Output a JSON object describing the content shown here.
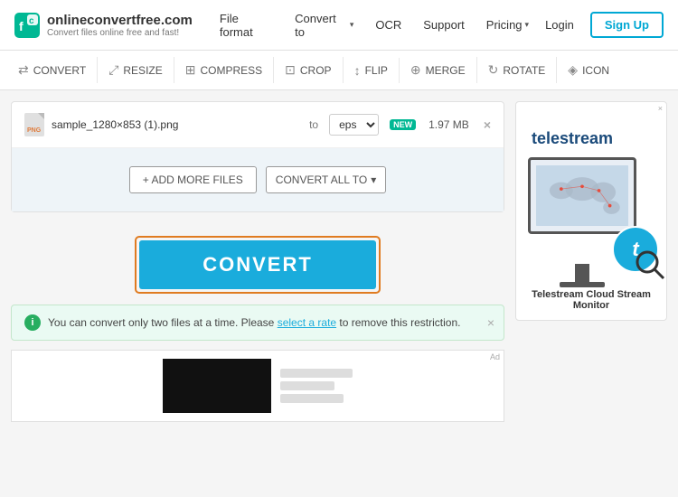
{
  "header": {
    "logo_title": "onlineconvertfree.com",
    "logo_subtitle": "Convert files online free and fast!",
    "nav_items": [
      {
        "label": "File format",
        "has_arrow": false
      },
      {
        "label": "Convert to",
        "has_arrow": true
      },
      {
        "label": "OCR",
        "has_arrow": false
      },
      {
        "label": "Support",
        "has_arrow": false
      },
      {
        "label": "Pricing",
        "has_arrow": true
      }
    ],
    "login_label": "Login",
    "signup_label": "Sign Up"
  },
  "toolbar": {
    "items": [
      {
        "label": "CONVERT",
        "icon": "⇄"
      },
      {
        "label": "RESIZE",
        "icon": "⤢"
      },
      {
        "label": "COMPRESS",
        "icon": "⊞"
      },
      {
        "label": "CROP",
        "icon": "⊡"
      },
      {
        "label": "FLIP",
        "icon": "↕"
      },
      {
        "label": "MERGE",
        "icon": "⊕"
      },
      {
        "label": "ROTATE",
        "icon": "↻"
      },
      {
        "label": "ICON",
        "icon": "◈"
      }
    ]
  },
  "file_converter": {
    "file_name": "sample_1280×853 (1).png",
    "file_type": "png",
    "to_label": "to",
    "format_value": "eps",
    "new_badge": "NEW",
    "file_size": "1.97 MB",
    "remove_icon": "×",
    "add_more_label": "+ ADD MORE FILES",
    "convert_all_label": "CONVERT ALL TO",
    "convert_btn_label": "CONVERT"
  },
  "info_banner": {
    "text": "You can convert only two files at a time. Please ",
    "link_text": "select a rate",
    "text_after": " to remove this restriction.",
    "close_icon": "×"
  },
  "ad_right": {
    "ad_label": "×",
    "brand_name": "telestream",
    "caption": "Telestream Cloud Stream Monitor"
  },
  "ad_bottom": {
    "ad_label": "Ad"
  }
}
